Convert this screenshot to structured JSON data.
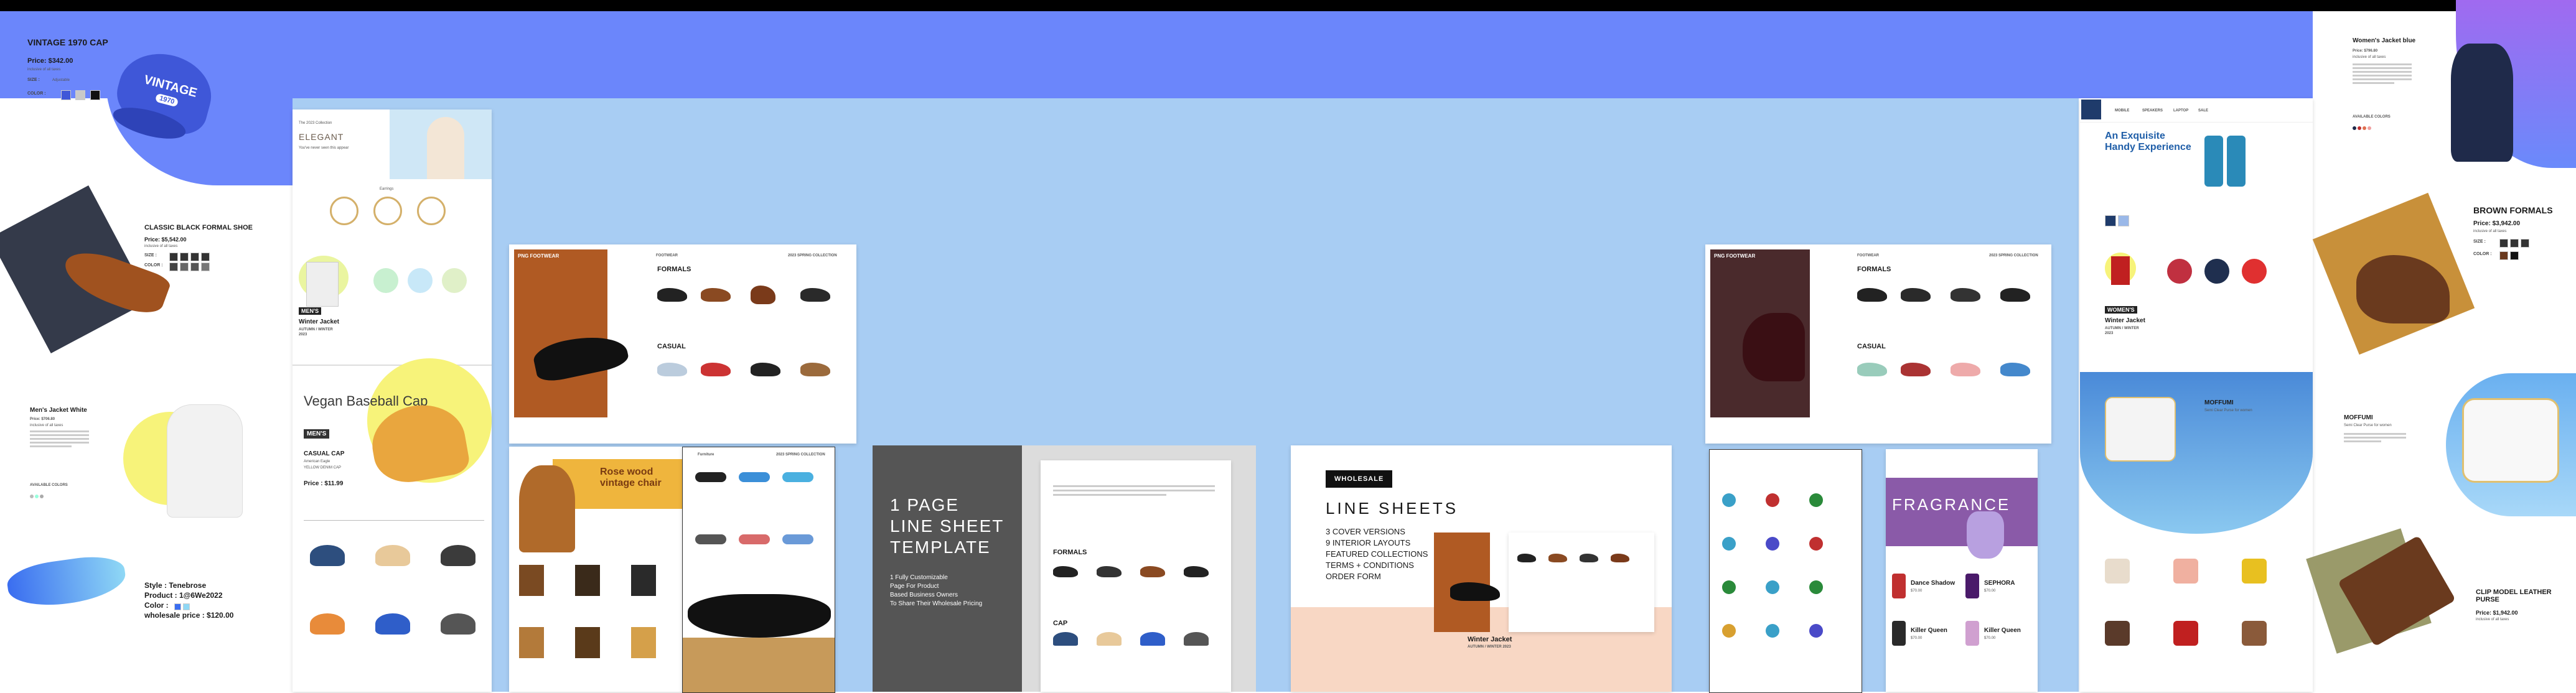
{
  "vintage_cap": {
    "title": "VINTAGE 1970 CAP",
    "price": "Price: $342.00",
    "tax": "inclusive of all taxes",
    "size_label": "SIZE :",
    "size_value": "Adjustable",
    "color_label": "COLOR :",
    "cap_text": "VINTAGE",
    "cap_badge": "1970"
  },
  "formal_shoe": {
    "title": "CLASSIC BLACK FORMAL SHOE",
    "price": "Price: $5,542.00",
    "tax": "inclusive of all taxes",
    "size_label": "SIZE :",
    "color_label": "COLOR :"
  },
  "mens_jacket_white": {
    "title": "Men's Jacket White",
    "price": "Price: $706.80",
    "tax": "inclusive of all taxes",
    "availability": "AVAILABLE COLORS"
  },
  "sunglasses": {
    "style": "Style : Tenebrose",
    "product": "Product : 1@6We2022",
    "color": "Color :",
    "wholesale": "wholesale price : $120.00"
  },
  "page_a": {
    "collection": "The 2023 Collection",
    "title": "ELEGANT",
    "subtitle": "You've never seen this appear",
    "earrings_label": "Earrings",
    "mens_tag": "MEN'S",
    "winter_jacket": "Winter Jacket",
    "season": "AUTUMN / WINTER 2023",
    "cap_title": "Vegan Baseball Cap",
    "cap_mens": "MEN'S",
    "casual_cap": "CASUAL CAP",
    "cap_detail1": "American Eagle",
    "cap_detail2": "YELLOW DENIM CAP",
    "cap_price": "Price : $11.99"
  },
  "page_b": {
    "brand": "PNG FOOTWEAR",
    "header_left": "FOOTWEAR",
    "header_right": "2023 SPRING COLLECTION",
    "formals": "FORMALS",
    "casual": "CASUAL",
    "chair_title": "Rose wood vintage chair",
    "furniture": "Furniture",
    "collection": "2023 SPRING COLLECTION"
  },
  "line_sheet_template": {
    "title_line1": "1 PAGE",
    "title_line2": "LINE SHEET",
    "title_line3": "TEMPLATE",
    "bullets": [
      "1 Fully Customizable",
      "Page For Product",
      "Based Business Owners",
      "To Share Their Wholesale Pricing"
    ],
    "formals": "FORMALS",
    "cap": "CAP"
  },
  "line_sheets": {
    "badge": "WHOLESALE",
    "title": "LINE SHEETS",
    "items": [
      "3 COVER VERSIONS",
      "9 INTERIOR LAYOUTS",
      "FEATURED COLLECTIONS",
      "TERMS + CONDITIONS",
      "ORDER FORM"
    ],
    "winter_jacket": "Winter Jacket",
    "season": "AUTUMN / WINTER 2023"
  },
  "page_c": {
    "brand": "PNG FOOTWEAR",
    "header_left": "FOOTWEAR",
    "header_right": "2023 SPRING COLLECTION",
    "formals": "FORMALS",
    "casual": "CASUAL",
    "fragrance": "FRAGRANCE",
    "perfumes": [
      {
        "name": "Dance Shadow",
        "price": "$70.00"
      },
      {
        "name": "SEPHORA",
        "price": "$70.00"
      },
      {
        "name": "Killer Queen",
        "price": "$70.00"
      },
      {
        "name": "Killer Queen",
        "price": "$70.00"
      }
    ]
  },
  "page_d": {
    "nav": [
      "MOBILE",
      "SPEAKERS",
      "LAPTOP",
      "SALE"
    ],
    "headline": "An Exquisite Handy Experience",
    "womens_tag": "WOMEN'S",
    "winter_jacket": "Winter Jacket",
    "season": "AUTUMN / WINTER 2023",
    "purse_title": "MOFFUMI",
    "purse_sub": "Semi Clear Purse for women"
  },
  "womens_jacket": {
    "title": "Women's Jacket blue",
    "price": "Price: $796.80",
    "tax": "inclusive of all taxes",
    "availability": "AVAILABLE COLORS"
  },
  "brown_formals": {
    "title": "BROWN FORMALS",
    "price": "Price: $3,942.00",
    "tax": "inclusive of all taxes",
    "size_label": "SIZE :",
    "color_label": "COLOR :"
  },
  "purse_right": {
    "title": "MOFFUMI",
    "subtitle": "Semi Clear Purse for women"
  },
  "clip_purse": {
    "title": "CLIP MODEL LEATHER PURSE",
    "price": "Price: $1,942.00",
    "tax": "inclusive of all taxes"
  },
  "colors": {
    "topbar": "#000000",
    "blue_header": "#6b86fb",
    "sky": "#a8cdf3",
    "accent_orange": "#b05a23",
    "accent_yellow": "#f7f37a",
    "dark": "#2f2f2f"
  }
}
